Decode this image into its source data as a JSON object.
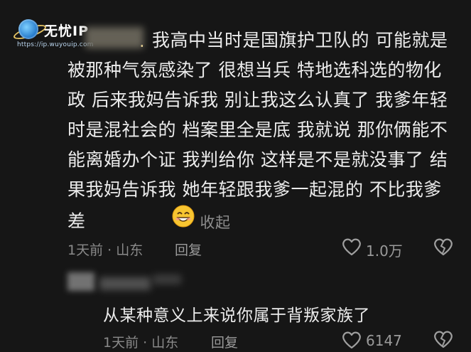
{
  "watermark": {
    "name": "无忧IP",
    "url": "https://ip.wuyouip.com"
  },
  "comment1": {
    "text": "我高中当时是国旗护卫队的 可能就是被那种气氛感染了 很想当兵 特地选科选的物化政 后来我妈告诉我 别让我这么认真了 我爹年轻时是混社会的 档案里全是底 我就说 那你俩能不能离婚办个证 我判给你 这样是不是就没事了 结果我妈告诉我 她年轻跟我爹一起混的 不比我爹差",
    "emoji": "smiling-face-emoji",
    "collapse_label": "收起",
    "time_location": "1天前 · 山东",
    "reply_label": "回复",
    "like_count": "1.0万"
  },
  "comment2": {
    "text": "从某种意义上来说你属于背叛家族了",
    "time_location": "1天前 · 山东",
    "reply_label": "回复",
    "like_count": "6147"
  }
}
